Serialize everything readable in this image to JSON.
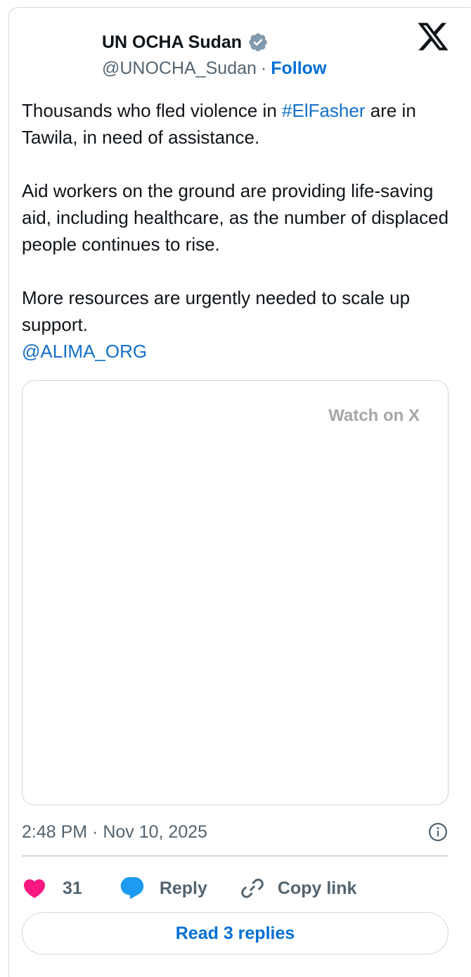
{
  "author": {
    "display_name": "UN OCHA Sudan",
    "handle": "@UNOCHA_Sudan",
    "separator": "·",
    "follow_label": "Follow"
  },
  "tweet": {
    "line1_before": "Thousands who fled violence in ",
    "hashtag": "#ElFasher",
    "line1_after": " are in Tawila, in need of assistance.",
    "paragraph2": "Aid workers on the ground are providing life-saving aid, including healthcare, as the number of displaced people continues to rise.",
    "paragraph3": "More resources are urgently needed to scale up support.",
    "mention": "@ALIMA_ORG"
  },
  "media": {
    "watch_label": "Watch on X"
  },
  "meta": {
    "timestamp": "2:48 PM · Nov 10, 2025"
  },
  "actions": {
    "like_count": "31",
    "reply_label": "Reply",
    "copy_link_label": "Copy link"
  },
  "footer": {
    "read_replies_label": "Read 3 replies"
  },
  "colors": {
    "like": "#f91880",
    "reply": "#1d9bf0",
    "link": "#006fd6",
    "verified": "#829aab"
  }
}
